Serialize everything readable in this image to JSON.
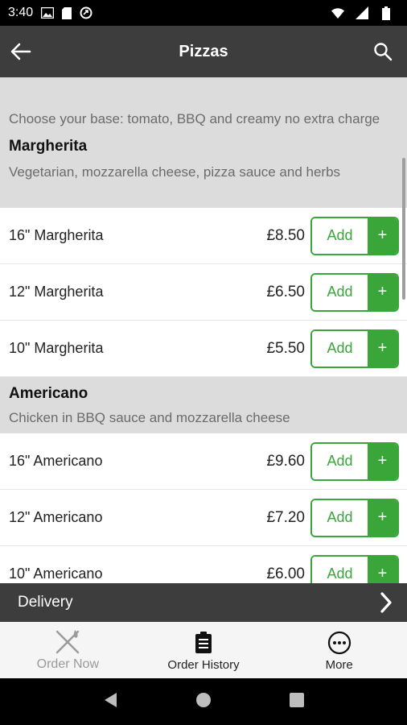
{
  "status_bar": {
    "time": "3:40"
  },
  "header": {
    "title": "Pizzas"
  },
  "intro": "Choose your base: tomato, BBQ and creamy no extra charge",
  "sections": [
    {
      "name": "Margherita",
      "description": "Vegetarian, mozzarella cheese, pizza sauce and herbs",
      "items": [
        {
          "name": "16\" Margherita",
          "price": "£8.50"
        },
        {
          "name": "12\" Margherita",
          "price": "£6.50"
        },
        {
          "name": "10\" Margherita",
          "price": "£5.50"
        }
      ]
    },
    {
      "name": "Americano",
      "description": "Chicken in BBQ sauce and mozzarella cheese",
      "items": [
        {
          "name": "16\" Americano",
          "price": "£9.60"
        },
        {
          "name": "12\" Americano",
          "price": "£7.20"
        },
        {
          "name": "10\" Americano",
          "price": "£6.00"
        }
      ]
    }
  ],
  "buttons": {
    "add": "Add",
    "plus": "+"
  },
  "delivery": {
    "label": "Delivery"
  },
  "bottom_nav": [
    {
      "label": "Order Now",
      "icon": "cutlery-icon",
      "state": "disabled"
    },
    {
      "label": "Order History",
      "icon": "clipboard-icon",
      "state": "normal"
    },
    {
      "label": "More",
      "icon": "more-icon",
      "state": "normal"
    }
  ],
  "colors": {
    "accent": "#3aa63a",
    "app_bar": "#3d3d3d",
    "section_bg": "#dcdcdc"
  }
}
